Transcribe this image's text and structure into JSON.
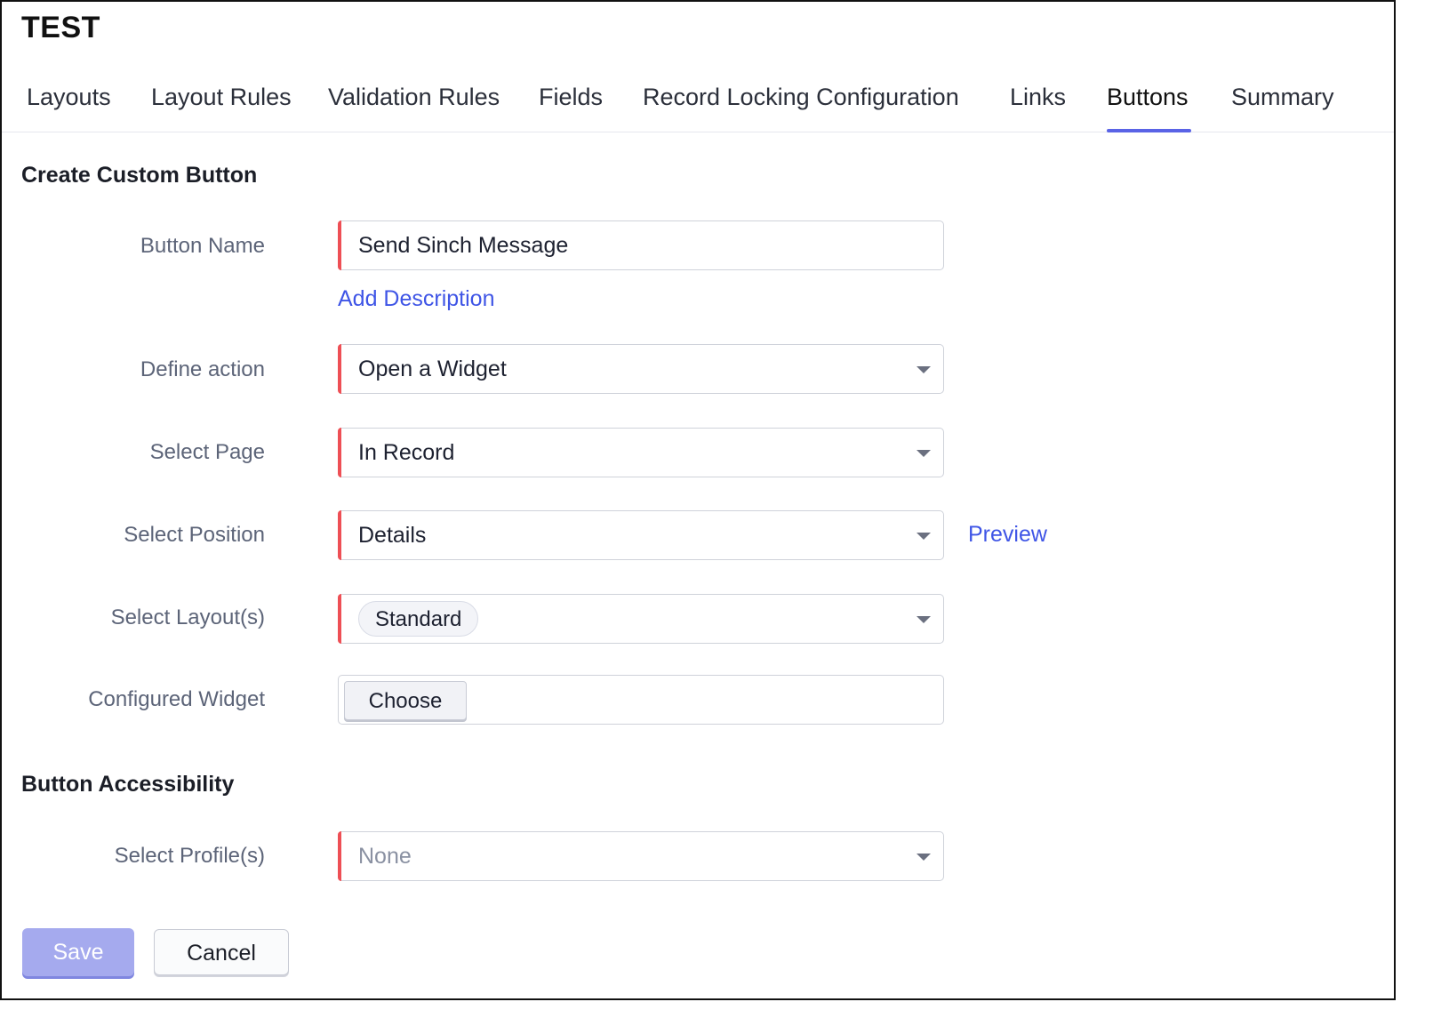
{
  "module_title": "TEST",
  "tabs": [
    {
      "label": "Layouts"
    },
    {
      "label": "Layout Rules"
    },
    {
      "label": "Validation Rules"
    },
    {
      "label": "Fields"
    },
    {
      "label": "Record Locking Configuration"
    },
    {
      "label": "Links"
    },
    {
      "label": "Buttons",
      "active": true
    },
    {
      "label": "Summary"
    }
  ],
  "create_section": {
    "title": "Create Custom Button",
    "button_name": {
      "label": "Button Name",
      "value": "Send Sinch Message"
    },
    "add_description": "Add Description",
    "define_action": {
      "label": "Define action",
      "value": "Open a Widget"
    },
    "select_page": {
      "label": "Select Page",
      "value": "In Record"
    },
    "select_position": {
      "label": "Select Position",
      "value": "Details",
      "preview_link": "Preview"
    },
    "select_layouts": {
      "label": "Select Layout(s)",
      "chip": "Standard"
    },
    "configured_widget": {
      "label": "Configured Widget",
      "choose_label": "Choose"
    }
  },
  "accessibility_section": {
    "title": "Button Accessibility",
    "select_profiles": {
      "label": "Select Profile(s)",
      "placeholder": "None"
    }
  },
  "actions": {
    "save_label": "Save",
    "cancel_label": "Cancel"
  },
  "colors": {
    "accent": "#5a63e6",
    "link": "#3f55e6",
    "required_marker": "#ee4f55",
    "save_disabled": "#a5aaee"
  }
}
